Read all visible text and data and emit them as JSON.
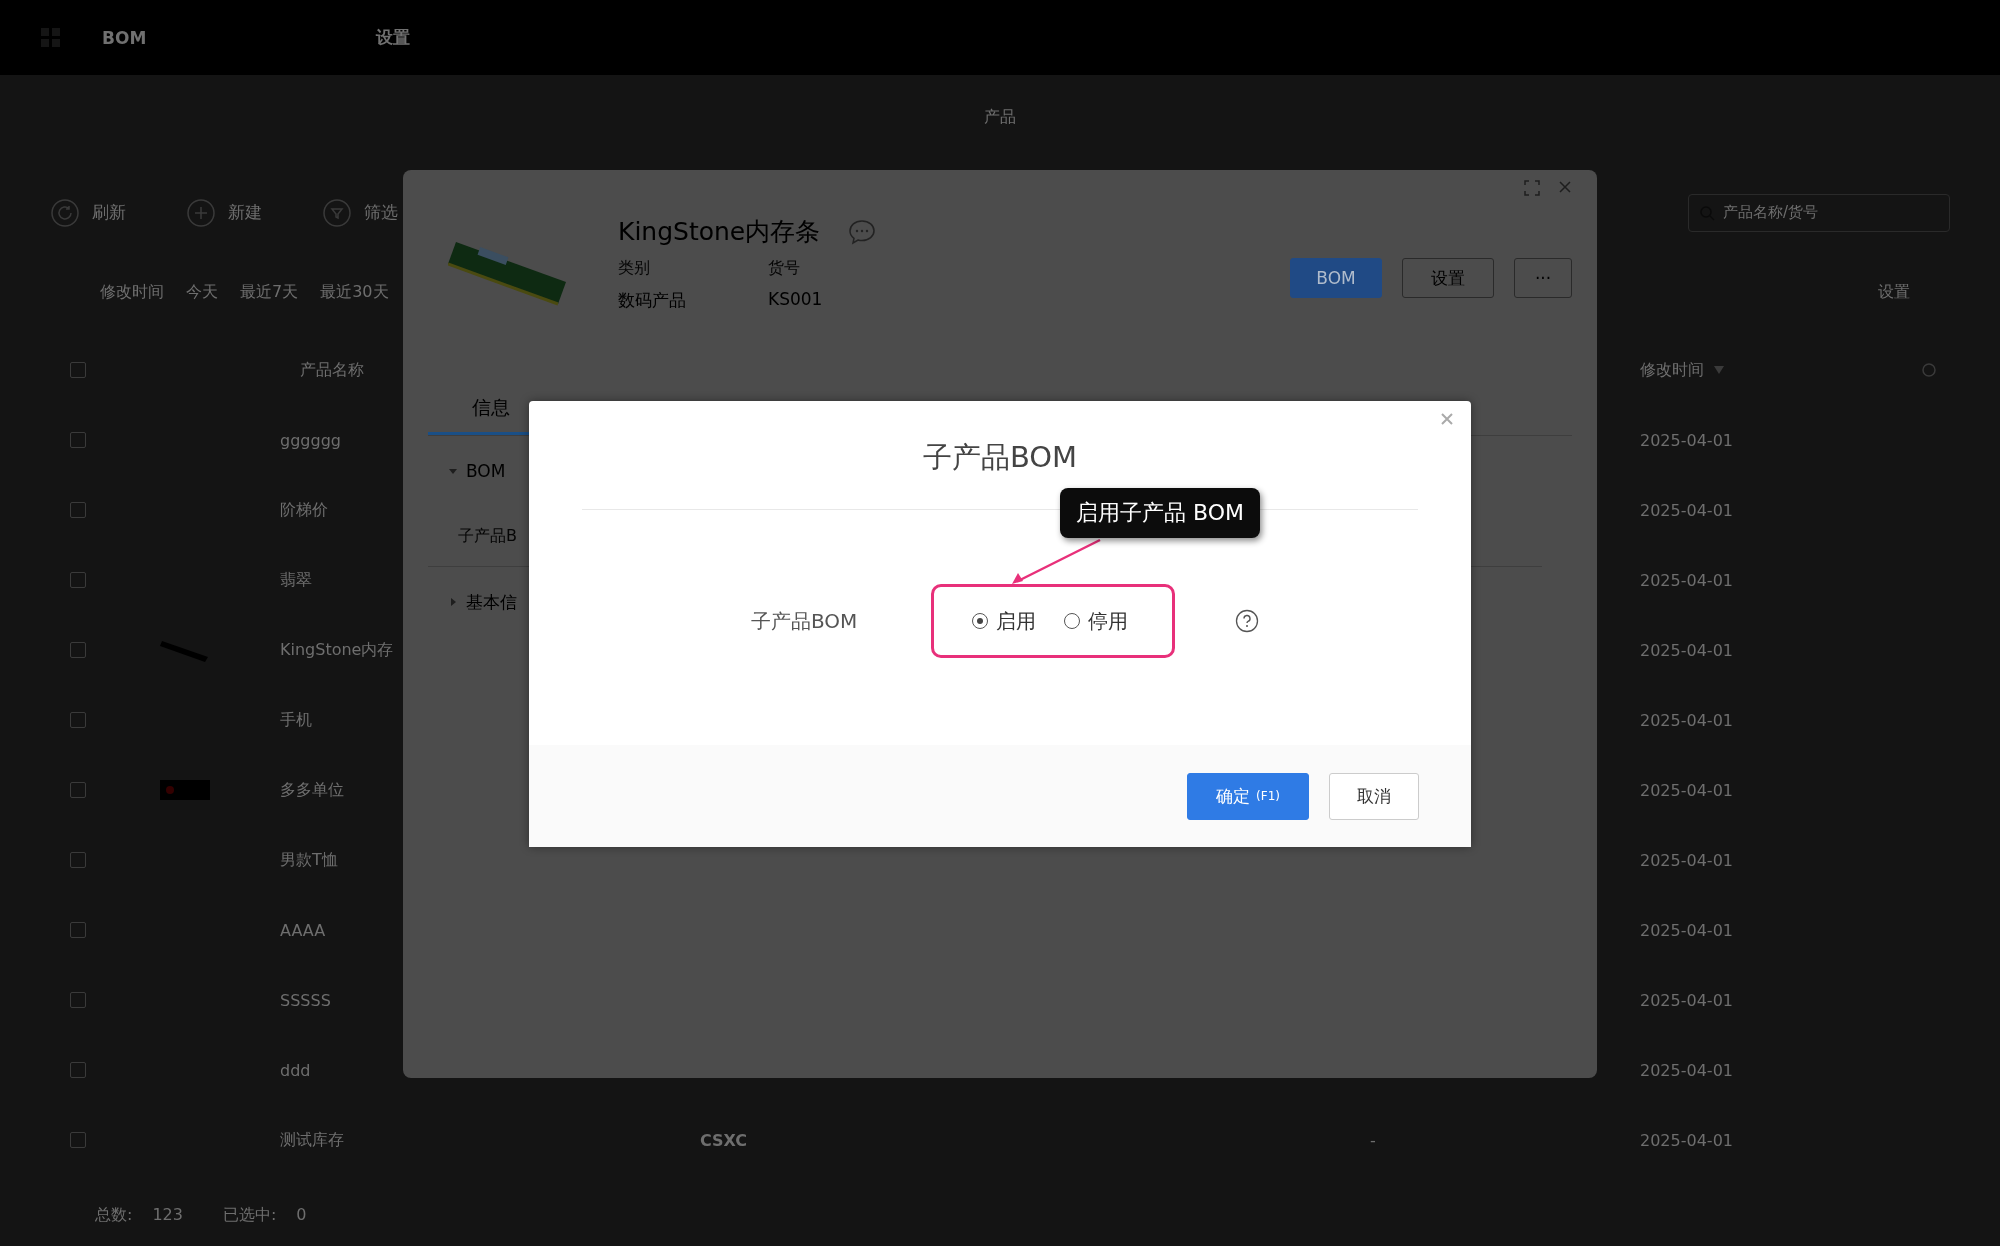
{
  "topbar": {
    "brand": "BOM",
    "nav": [
      {
        "label": "设置"
      }
    ]
  },
  "page": {
    "title": "产品",
    "toolbar": [
      {
        "kind": "refresh",
        "label": "刷新"
      },
      {
        "kind": "add",
        "label": "新建"
      },
      {
        "kind": "filter",
        "label": "筛选"
      }
    ],
    "search": {
      "placeholder": "产品名称/货号"
    },
    "filters": [
      {
        "label": "修改时间"
      },
      {
        "label": "今天"
      },
      {
        "label": "最近7天"
      },
      {
        "label": "最近30天"
      }
    ],
    "settings_link": "设置",
    "table": {
      "columns": [
        "产品名称",
        "修改时间"
      ],
      "select_all_checked": false,
      "rows": [
        {
          "checked": false,
          "name": "gggggg",
          "date": "2025-04-01"
        },
        {
          "checked": false,
          "name": "阶梯价",
          "date": "2025-04-01"
        },
        {
          "checked": false,
          "name": "翡翠",
          "date": "2025-04-01"
        },
        {
          "checked": false,
          "name": "KingStone内存",
          "date": "2025-04-01"
        },
        {
          "checked": false,
          "name": "手机",
          "date": "2025-04-01"
        },
        {
          "checked": false,
          "name": "多多单位",
          "date": "2025-04-01"
        },
        {
          "checked": false,
          "name": "男款T恤",
          "date": "2025-04-01"
        },
        {
          "checked": false,
          "name": "AAAA",
          "date": "2025-04-01"
        },
        {
          "checked": false,
          "name": "SSSSS",
          "date": "2025-04-01"
        },
        {
          "checked": false,
          "name": "ddd",
          "date": "2025-04-01"
        },
        {
          "checked": false,
          "name": "测试库存",
          "column_3": "CSXC",
          "column_4": "-",
          "date": "2025-04-01"
        }
      ]
    },
    "footer": [
      {
        "label": "总数:",
        "value": "123"
      },
      {
        "label": "已选中:",
        "value": "0"
      }
    ]
  },
  "product_modal": {
    "title": "KingStone内存条",
    "fields": [
      {
        "label": "类别",
        "value": "数码产品"
      },
      {
        "label": "货号",
        "value": "KS001"
      }
    ],
    "buttons": [
      {
        "kind": "primary",
        "label": "BOM"
      },
      {
        "kind": "default",
        "label": "设置"
      },
      {
        "kind": "more",
        "label": "···"
      }
    ],
    "tabs": [
      {
        "label": "信息",
        "selected": true
      }
    ],
    "sections": [
      {
        "title": "BOM",
        "expanded": true,
        "rows": [
          "子产品B"
        ]
      },
      {
        "title": "基本信",
        "expanded": false
      }
    ]
  },
  "dialog": {
    "title": "子产品BOM",
    "field_label": "子产品BOM",
    "options": [
      {
        "label": "启用",
        "selected": true
      },
      {
        "label": "停用",
        "selected": false
      }
    ],
    "callout": "启用子产品 BOM",
    "buttons": [
      {
        "kind": "primary",
        "label": "确定",
        "shortcut": "(F1)"
      },
      {
        "kind": "default",
        "label": "取消"
      }
    ]
  }
}
